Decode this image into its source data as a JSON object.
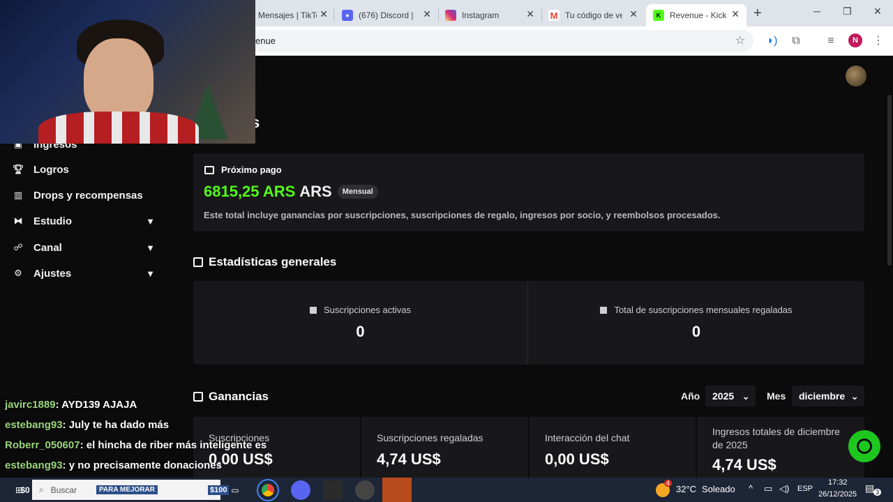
{
  "browser": {
    "tabs": [
      {
        "title": "Mensajes | TikTok",
        "favicon_color": "#111111"
      },
      {
        "title": "(676) Discord | #",
        "favicon_color": "#5865f2"
      },
      {
        "title": "Instagram",
        "favicon_color": "#d62976"
      },
      {
        "title": "Tu código de ve",
        "favicon_color": "#ea4335"
      },
      {
        "title": "Revenue - Kick D",
        "favicon_color": "#53fc18"
      }
    ],
    "active_tab_index": 4,
    "address": "enue",
    "profile_initial": "N"
  },
  "sidebar": {
    "items": [
      {
        "label": "Ingresos",
        "icon": "wallet-icon",
        "expandable": false
      },
      {
        "label": "Logros",
        "icon": "trophy-icon",
        "expandable": false
      },
      {
        "label": "Drops y recompensas",
        "icon": "drops-icon",
        "expandable": false
      },
      {
        "label": "Estudio",
        "icon": "studio-icon",
        "expandable": true
      },
      {
        "label": "Canal",
        "icon": "channel-icon",
        "expandable": true
      },
      {
        "label": "Ajustes",
        "icon": "gear-icon",
        "expandable": true
      }
    ]
  },
  "page": {
    "heading_fragment": "s"
  },
  "next_payment": {
    "title": "Próximo pago",
    "amount": "6815,25 ARS",
    "currency": "ARS",
    "badge": "Mensual",
    "description": "Este total incluye ganancias por suscripciones, suscripciones de regalo, ingresos por socio, y reembolsos procesados."
  },
  "general_stats": {
    "title": "Estadísticas generales",
    "items": [
      {
        "label": "Suscripciones activas",
        "value": "0"
      },
      {
        "label": "Total de suscripciones mensuales regaladas",
        "value": "0"
      }
    ]
  },
  "earnings": {
    "title": "Ganancias",
    "year_label": "Año",
    "year_value": "2025",
    "month_label": "Mes",
    "month_value": "diciembre",
    "items": [
      {
        "label": "Suscripciones",
        "value": "0,00 US$"
      },
      {
        "label": "Suscripciones regaladas",
        "value": "4,74 US$"
      },
      {
        "label": "Interacción del chat",
        "value": "0,00 US$"
      },
      {
        "label": "Ingresos totales de diciembre de 2025",
        "value": "4,74 US$"
      }
    ]
  },
  "chat": [
    {
      "user": "javirc1889",
      "message": ": AYD139 AJAJA"
    },
    {
      "user": "estebang93",
      "message": ": July te ha dado más"
    },
    {
      "user": "Roberr_050607",
      "message": ": el hincha de riber más inteligente es"
    },
    {
      "user": "estebang93",
      "message": ": y no precisamente donaciones"
    }
  ],
  "taskbar": {
    "search_placeholder": "Buscar",
    "banner_text": "PARA MEJORAR",
    "banner_price": "$100",
    "weather_temp": "32°C",
    "weather_desc": "Soleado",
    "weather_badge": "4",
    "language": "ESP",
    "time": "17:32",
    "date": "26/12/2025",
    "notification_count": "3",
    "left_chip": "$0"
  },
  "colors": {
    "kick_green": "#53fc18",
    "card_bg": "#18181b",
    "page_bg": "#0b0b0c"
  }
}
